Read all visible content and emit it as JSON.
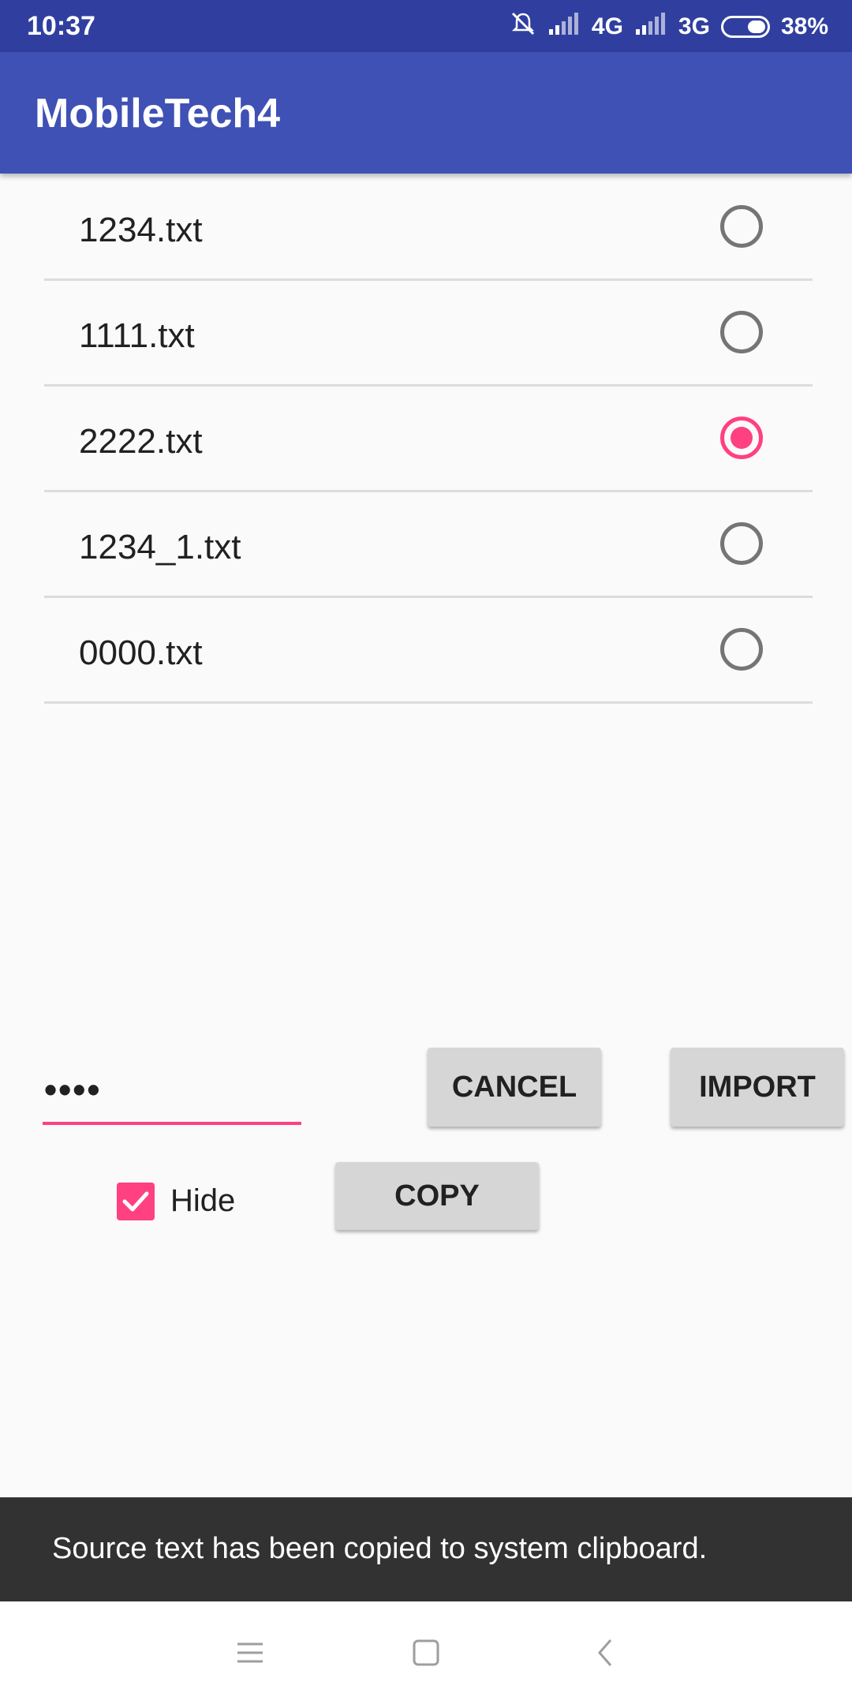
{
  "status_bar": {
    "time": "10:37",
    "network_1": "4G",
    "network_2": "3G",
    "battery": "38%"
  },
  "app_bar": {
    "title": "MobileTech4"
  },
  "files": [
    {
      "name": "1234.txt",
      "selected": false
    },
    {
      "name": "1111.txt",
      "selected": false
    },
    {
      "name": "2222.txt",
      "selected": true
    },
    {
      "name": "1234_1.txt",
      "selected": false
    },
    {
      "name": "0000.txt",
      "selected": false
    }
  ],
  "password_field": {
    "value": "••••"
  },
  "buttons": {
    "cancel": "CANCEL",
    "import": "IMPORT",
    "copy": "COPY"
  },
  "hide_checkbox": {
    "label": "Hide",
    "checked": true
  },
  "snackbar": {
    "message": "Source text has been copied to system clipboard."
  },
  "colors": {
    "primary": "#3f51b5",
    "primary_dark": "#303f9f",
    "accent": "#ff4081"
  },
  "icons": {
    "mute": "bell-off-icon",
    "signal": "signal-icon",
    "nav_menu": "menu-icon",
    "nav_home": "home-square-icon",
    "nav_back": "back-chevron-icon"
  }
}
